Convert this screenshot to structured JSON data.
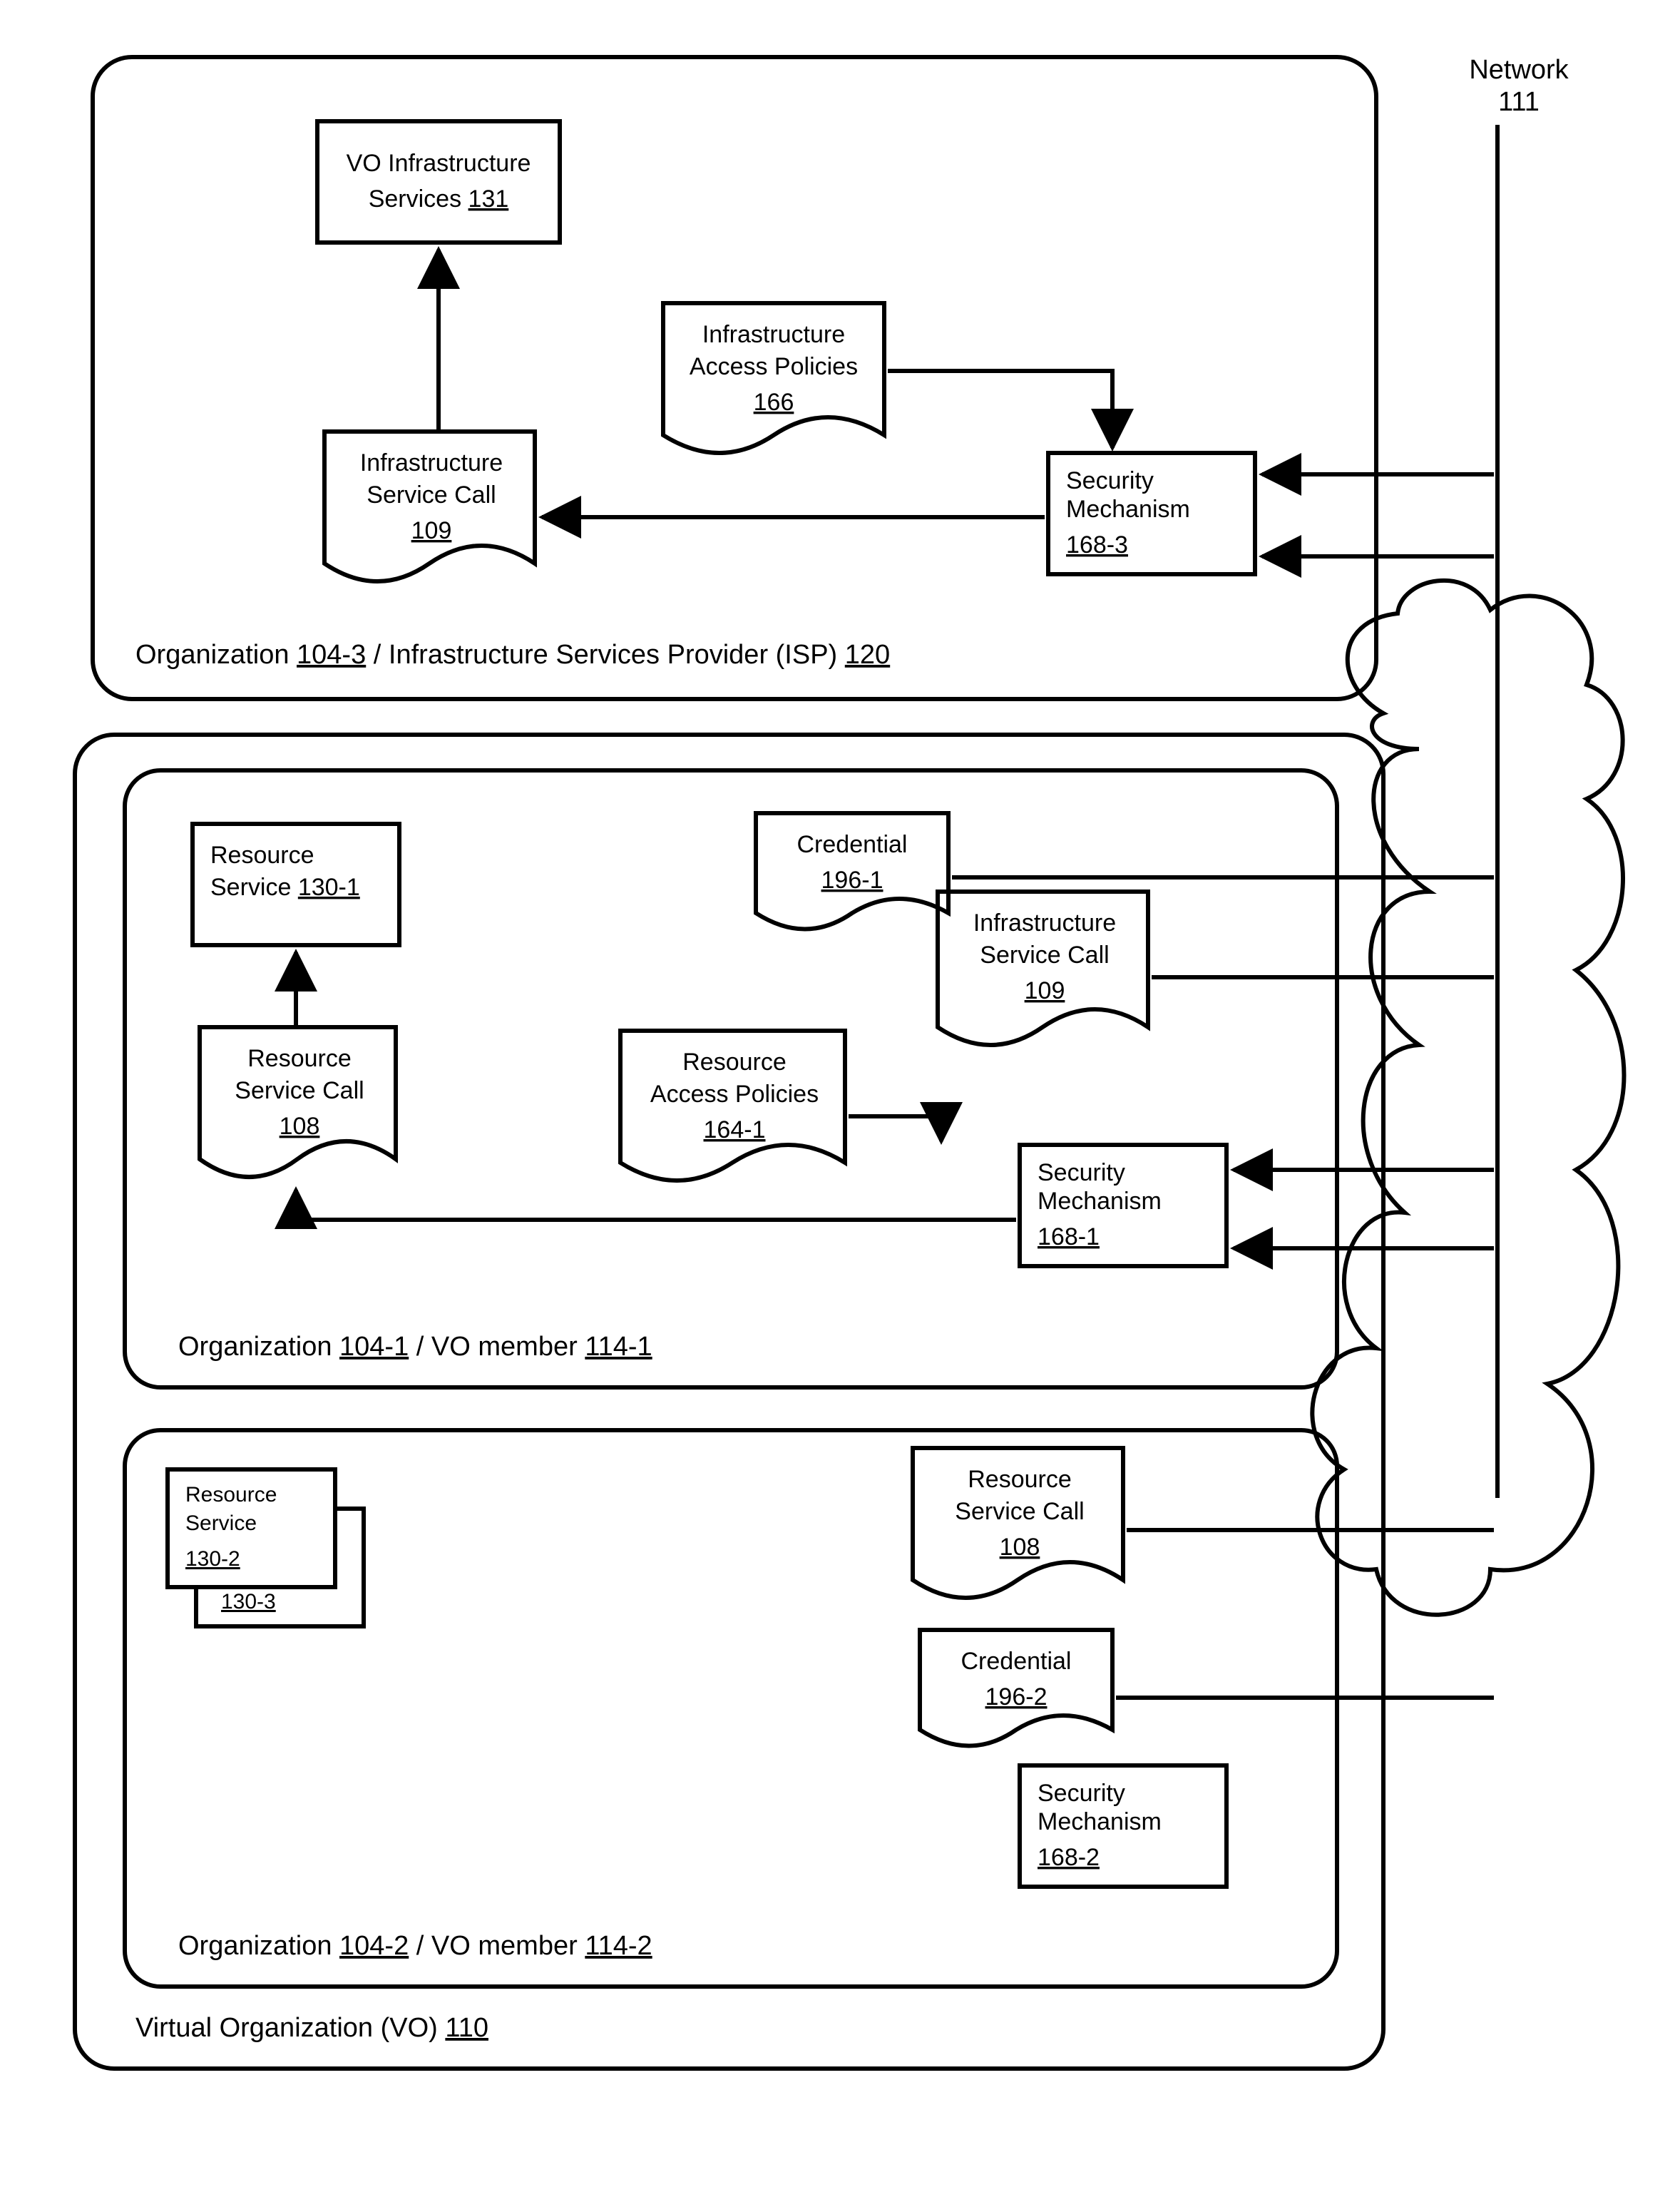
{
  "network": {
    "label": "Network",
    "ref": "111"
  },
  "vo": {
    "label": "Virtual Organization (VO)",
    "ref": "110"
  },
  "org3": {
    "label_pre": "Organization",
    "ref": "104-3",
    "mid": "/ Infrastructure Services Provider (ISP)",
    "ispref": "120",
    "vo_inf_serv": {
      "l1": "VO Infrastructure",
      "l2": "Services",
      "ref": "131"
    },
    "inf_call": {
      "l1": "Infrastructure",
      "l2": "Service Call",
      "ref": "109"
    },
    "inf_policies": {
      "l1": "Infrastructure",
      "l2": "Access Policies",
      "ref": "166"
    },
    "sec": {
      "l1": "Security",
      "l2": "Mechanism",
      "ref": "168-3"
    }
  },
  "org1": {
    "label_pre": "Organization",
    "ref": "104-1",
    "mid": "/ VO member",
    "memref": "114-1",
    "res_serv": {
      "l1": "Resource",
      "l2": "Service",
      "ref": "130-1"
    },
    "res_call": {
      "l1": "Resource",
      "l2": "Service Call",
      "ref": "108"
    },
    "res_policies": {
      "l1": "Resource",
      "l2": "Access Policies",
      "ref": "164-1"
    },
    "cred": {
      "l1": "Credential",
      "ref": "196-1"
    },
    "inf_call": {
      "l1": "Infrastructure",
      "l2": "Service Call",
      "ref": "109"
    },
    "sec": {
      "l1": "Security",
      "l2": "Mechanism",
      "ref": "168-1"
    }
  },
  "org2": {
    "label_pre": "Organization",
    "ref": "104-2",
    "mid": "/ VO member",
    "memref": "114-2",
    "res_serv1": {
      "l1": "Resource",
      "l2": "Service",
      "ref": "130-2"
    },
    "res_serv2": {
      "ref": "130-3"
    },
    "res_call": {
      "l1": "Resource",
      "l2": "Service Call",
      "ref": "108"
    },
    "cred": {
      "l1": "Credential",
      "ref": "196-2"
    },
    "sec": {
      "l1": "Security",
      "l2": "Mechanism",
      "ref": "168-2"
    }
  }
}
